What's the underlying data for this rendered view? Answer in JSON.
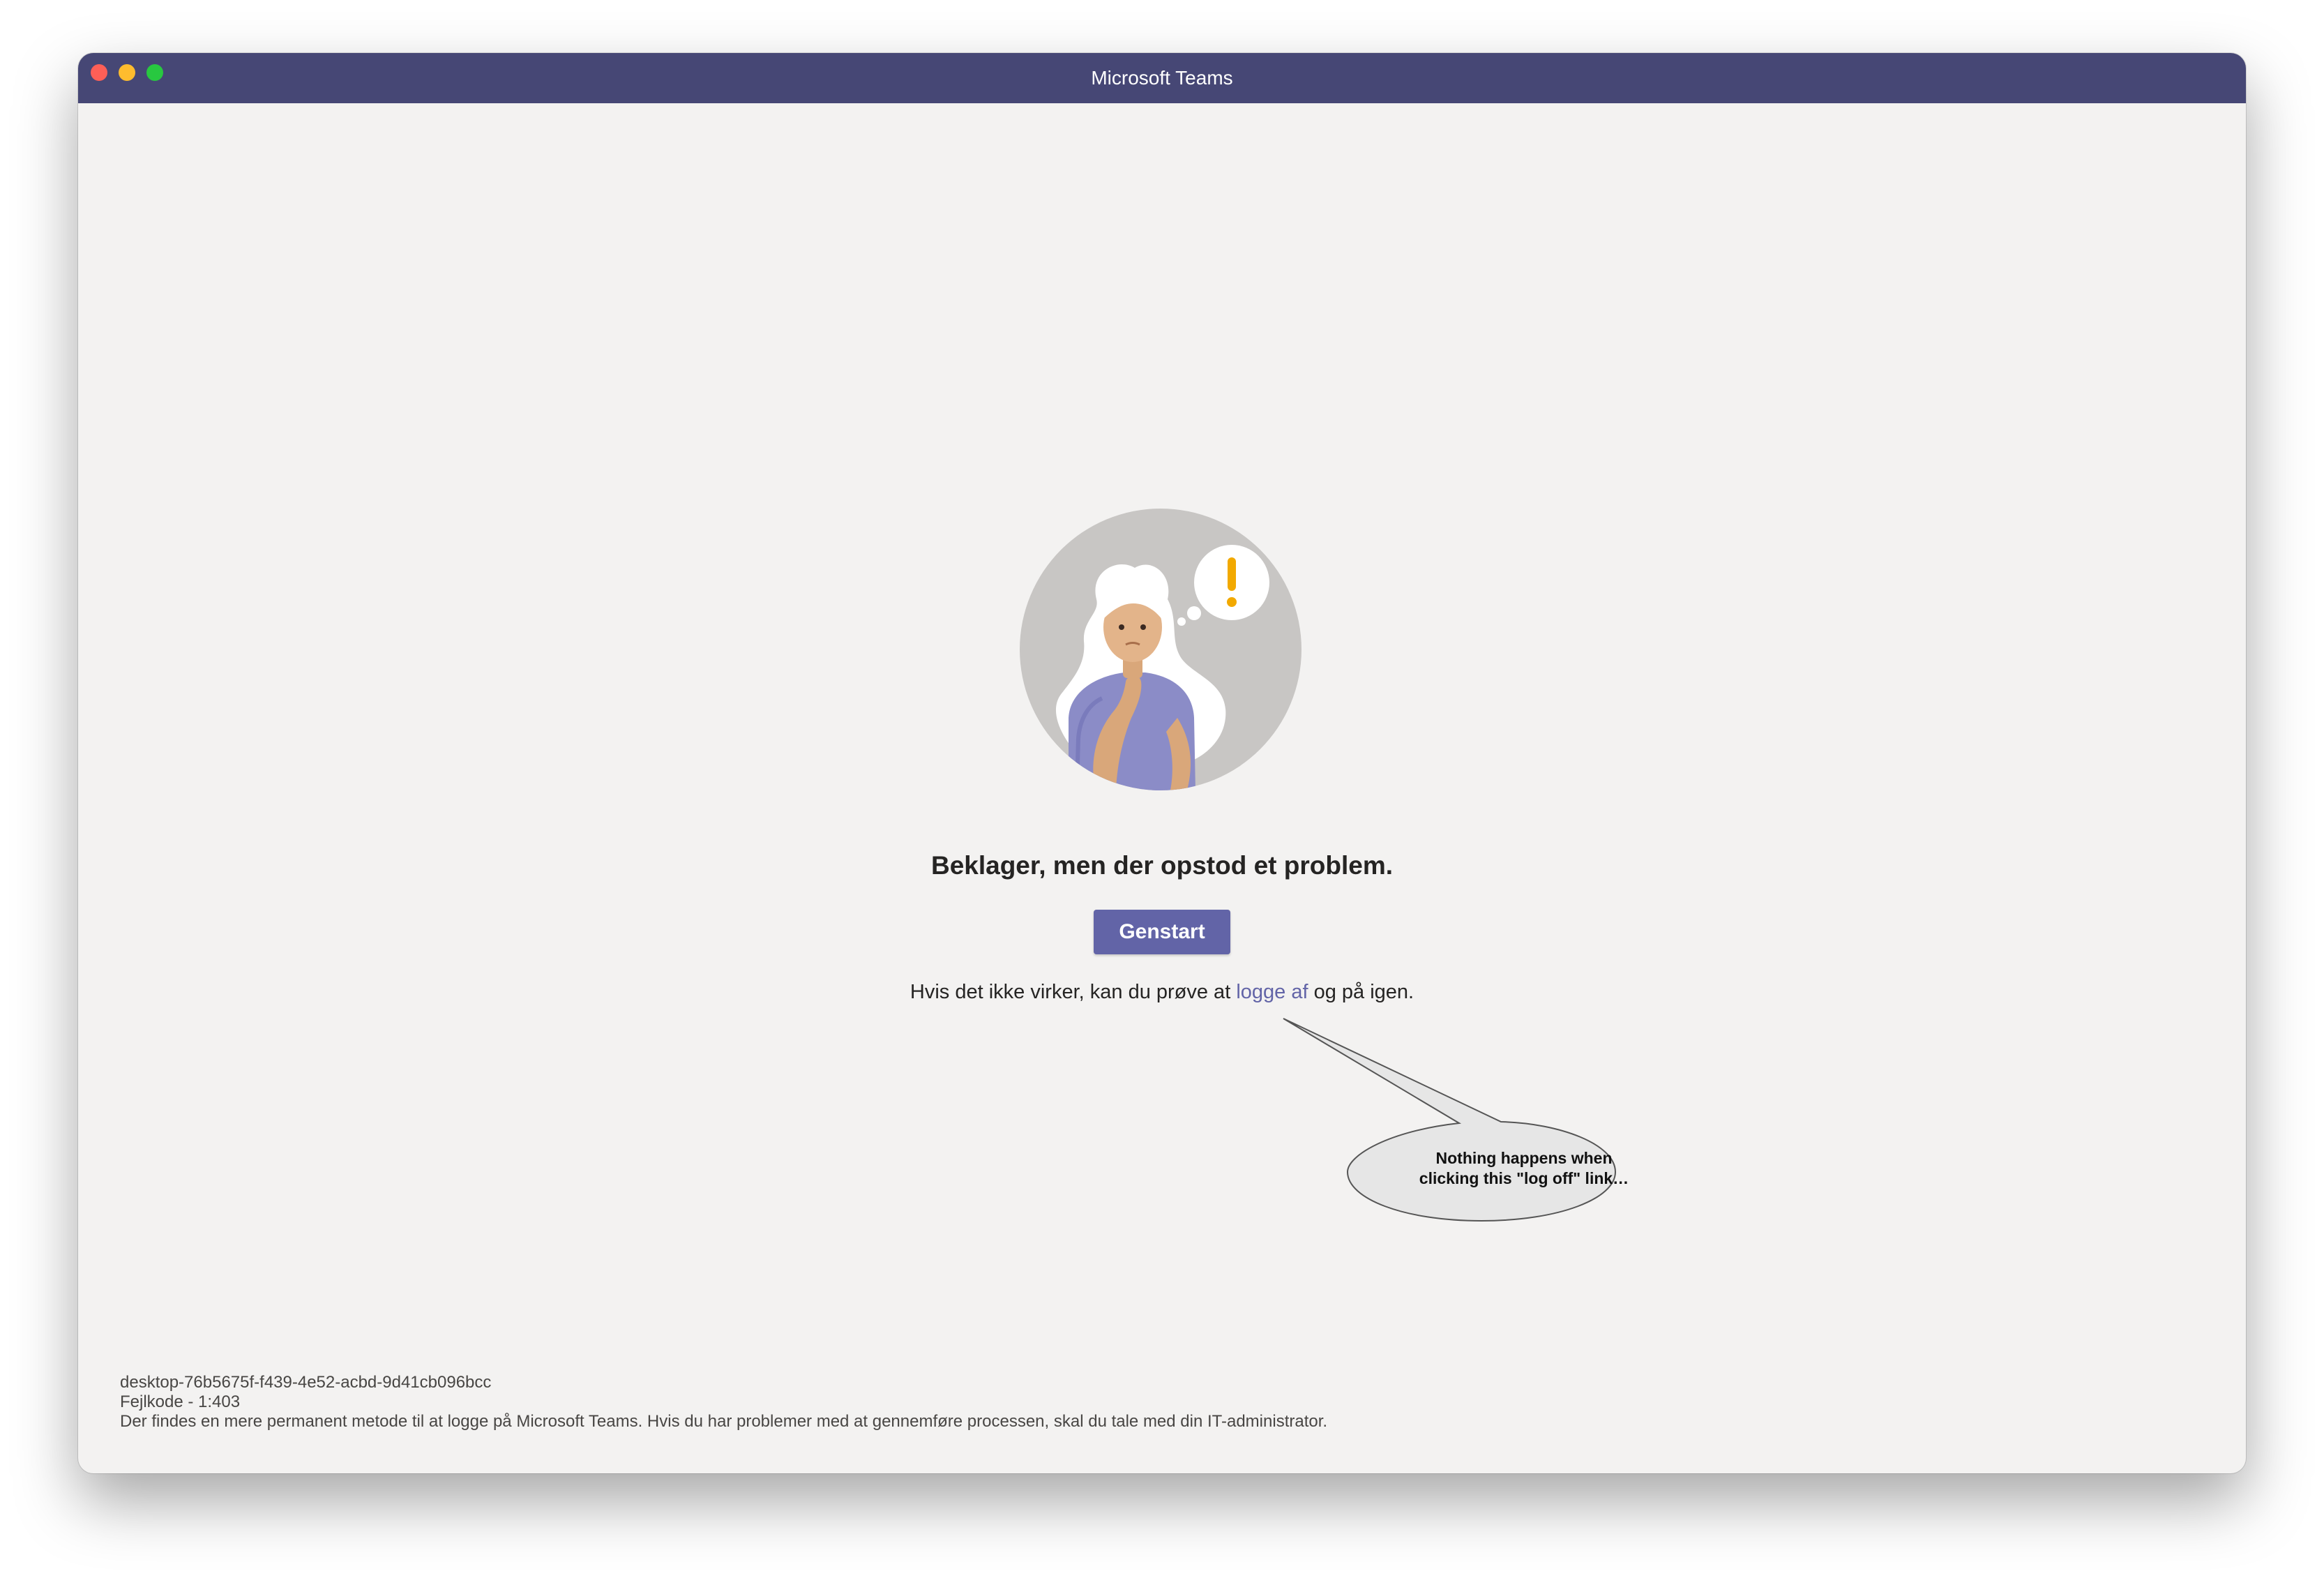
{
  "window": {
    "title": "Microsoft Teams",
    "controls": {
      "close": "close-control",
      "minimize": "minimize-control",
      "zoom": "zoom-control"
    }
  },
  "error": {
    "heading": "Beklager, men der opstod et problem.",
    "restart_label": "Genstart",
    "hint_before": "Hvis det ikke virker, kan du prøve at ",
    "hint_link": "logge af",
    "hint_after": " og på igen."
  },
  "annotation": {
    "line1": "Nothing happens when",
    "line2": "clicking this \"log off\" link…"
  },
  "footer": {
    "session_id": "desktop-76b5675f-f439-4e52-acbd-9d41cb096bcc",
    "error_code": "Fejlkode - 1:403",
    "message": "Der findes en mere permanent metode til at logge på Microsoft Teams. Hvis du har problemer med at gennemføre processen, skal du tale med din IT-administrator."
  },
  "colors": {
    "titlebar": "#464775",
    "accent": "#6264a7",
    "background": "#f3f2f1",
    "warning": "#f2a900"
  }
}
